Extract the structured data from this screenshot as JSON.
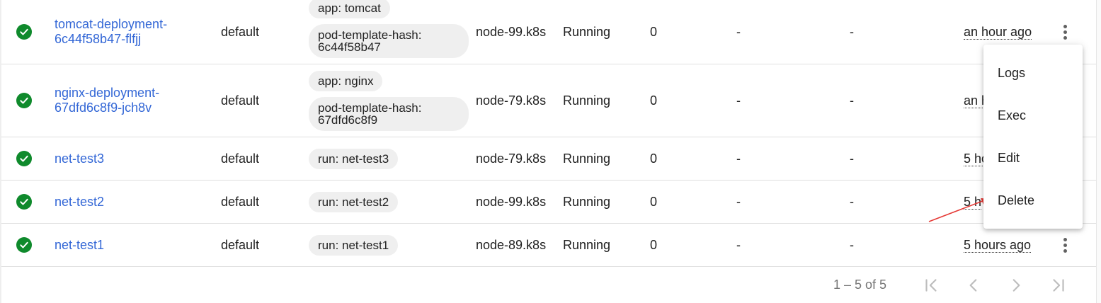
{
  "pods": [
    {
      "status": "check-circle-icon",
      "name": "tomcat-deployment-6c44f58b47-flfjj",
      "name_line1": "tomcat-deployment-",
      "name_line2": "6c44f58b47-flfjj",
      "namespace": "default",
      "labels": [
        "app: tomcat",
        "pod-template-hash: 6c44f58b47"
      ],
      "node": "node-99.k8s",
      "phase": "Running",
      "restarts": "0",
      "cpu": "-",
      "memory": "-",
      "age": "an hour ago"
    },
    {
      "status": "check-circle-icon",
      "name": "nginx-deployment-67dfd6c8f9-jch8v",
      "name_line1": "nginx-deployment-",
      "name_line2": "67dfd6c8f9-jch8v",
      "namespace": "default",
      "labels": [
        "app: nginx",
        "pod-template-hash: 67dfd6c8f9"
      ],
      "node": "node-79.k8s",
      "phase": "Running",
      "restarts": "0",
      "cpu": "-",
      "memory": "-",
      "age": "an h"
    },
    {
      "status": "check-circle-icon",
      "name": "net-test3",
      "namespace": "default",
      "labels": [
        "run: net-test3"
      ],
      "node": "node-79.k8s",
      "phase": "Running",
      "restarts": "0",
      "cpu": "-",
      "memory": "-",
      "age": "5 ho"
    },
    {
      "status": "check-circle-icon",
      "name": "net-test2",
      "namespace": "default",
      "labels": [
        "run: net-test2"
      ],
      "node": "node-99.k8s",
      "phase": "Running",
      "restarts": "0",
      "cpu": "-",
      "memory": "-",
      "age": "5 h"
    },
    {
      "status": "check-circle-icon",
      "name": "net-test1",
      "namespace": "default",
      "labels": [
        "run: net-test1"
      ],
      "node": "node-89.k8s",
      "phase": "Running",
      "restarts": "0",
      "cpu": "-",
      "memory": "-",
      "age": "5 hours ago"
    }
  ],
  "context_menu": {
    "items": [
      "Logs",
      "Exec",
      "Edit",
      "Delete"
    ]
  },
  "pagination": {
    "range": "1 – 5 of 5",
    "first_icon": "first-page-icon",
    "prev_icon": "chevron-left-icon",
    "next_icon": "chevron-right-icon",
    "last_icon": "last-page-icon"
  },
  "colors": {
    "link": "#3367d6",
    "status_ok": "#0f8a2c",
    "annotation_arrow": "#e53935",
    "chip_bg": "#efefef"
  }
}
